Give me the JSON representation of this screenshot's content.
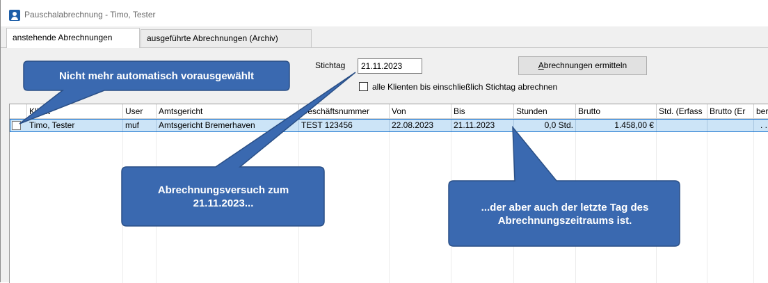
{
  "window": {
    "title": "Pauschalabrechnung - Timo, Tester"
  },
  "tabs": [
    {
      "label": "anstehende Abrechnungen",
      "active": true
    },
    {
      "label": "ausgeführte Abrechnungen (Archiv)",
      "active": false
    }
  ],
  "form": {
    "stichtag_label": "Stichtag",
    "stichtag_value": "21.11.2023",
    "calc_button": "Abrechnungen ermitteln",
    "calc_button_mnemonic": "A",
    "calc_button_rest": "brechnungen ermitteln",
    "checkbox_label": "alle Klienten bis einschließlich Stichtag abrechnen",
    "checkbox_checked": false
  },
  "table": {
    "columns": [
      "Klient",
      "User",
      "Amtsgericht",
      "Geschäftsnummer",
      "Von",
      "Bis",
      "Stunden",
      "Brutto",
      "Std. (Erfass",
      "Brutto (Er",
      "bere"
    ],
    "rows": [
      {
        "checked": false,
        "cells": [
          "Timo, Tester",
          "muf",
          "Amtsgericht Bremerhaven",
          "TEST 123456",
          "22.08.2023",
          "21.11.2023",
          "0,0 Std.",
          "1.458,00 €",
          "",
          "",
          ". ."
        ]
      }
    ]
  },
  "annotations": {
    "callout1": "Nicht mehr automatisch vorausgewählt",
    "callout2": "Abrechnungsversuch zum 21.11.2023...",
    "callout3": "...der aber auch der letzte Tag des Abrechnungszeitraums ist."
  },
  "colors": {
    "callout_fill": "#3a69b0",
    "callout_border": "#2a4f86",
    "selection": "#cce4f7"
  }
}
